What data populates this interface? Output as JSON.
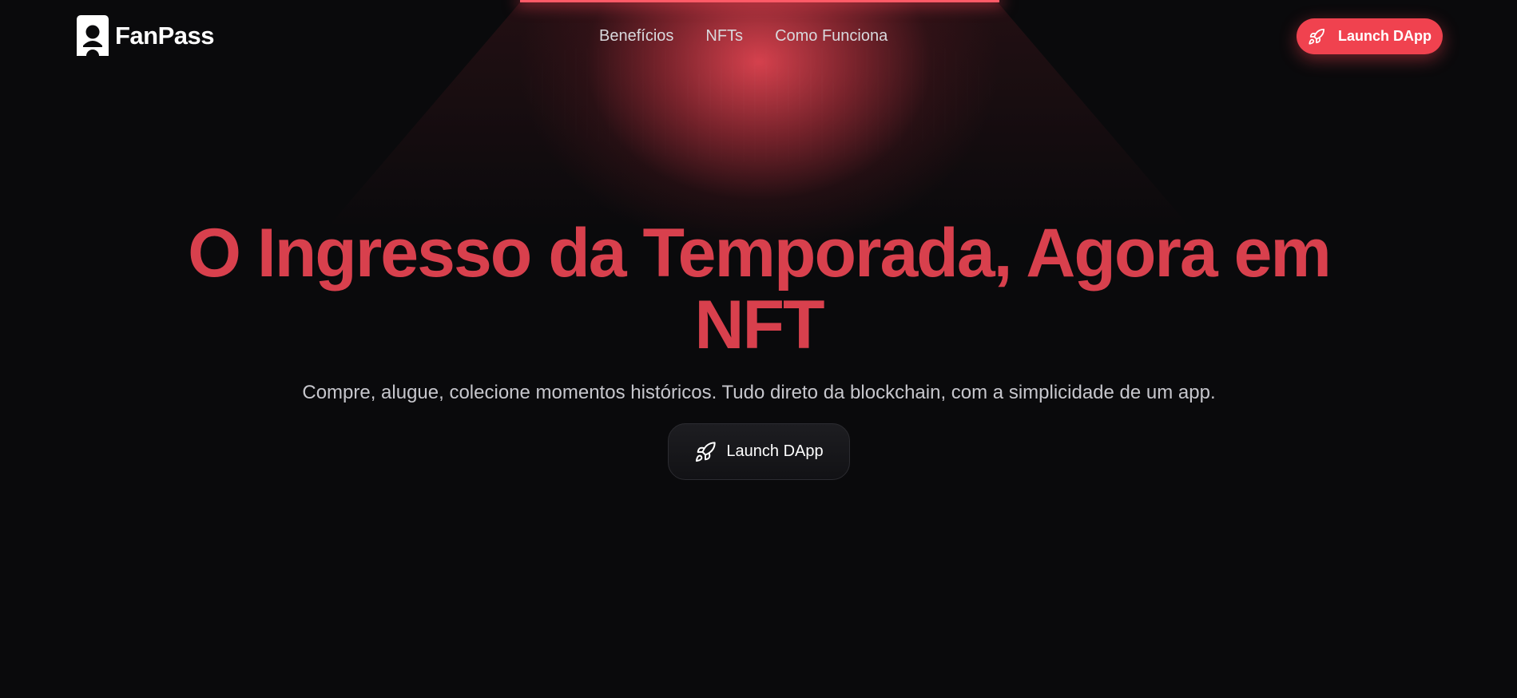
{
  "brand": {
    "name": "FanPass",
    "icon": "ticket-logo-icon"
  },
  "nav": {
    "items": [
      {
        "label": "Benefícios"
      },
      {
        "label": "NFTs"
      },
      {
        "label": "Como Funciona"
      }
    ]
  },
  "header_cta": {
    "label": "Launch DApp",
    "icon": "rocket-icon"
  },
  "hero": {
    "title": "O Ingresso da Temporada, Agora em NFT",
    "subtitle": "Compre, alugue, colecione momentos históricos. Tudo direto da blockchain, com a simplicidade de um app.",
    "cta": {
      "label": "Launch DApp",
      "icon": "rocket-icon"
    }
  },
  "colors": {
    "background": "#0a0a0c",
    "accent": "#f0424f",
    "title": "#d8404d",
    "subtitle": "#c6c6cc",
    "nav_text": "#d9d9dd"
  }
}
